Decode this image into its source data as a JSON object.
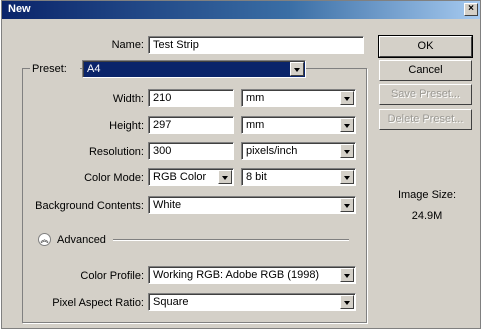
{
  "window": {
    "title": "New",
    "close": "×"
  },
  "labels": {
    "name": "Name:",
    "preset": "Preset:",
    "width": "Width:",
    "height": "Height:",
    "resolution": "Resolution:",
    "color_mode": "Color Mode:",
    "background_contents": "Background Contents:",
    "advanced": "Advanced",
    "color_profile": "Color Profile:",
    "pixel_aspect_ratio": "Pixel Aspect Ratio:"
  },
  "values": {
    "name": "Test Strip",
    "preset": "A4",
    "width": "210",
    "width_unit": "mm",
    "height": "297",
    "height_unit": "mm",
    "resolution": "300",
    "resolution_unit": "pixels/inch",
    "color_mode": "RGB Color",
    "bit_depth": "8 bit",
    "background_contents": "White",
    "color_profile": "Working RGB:  Adobe RGB (1998)",
    "pixel_aspect_ratio": "Square"
  },
  "buttons": {
    "ok": "OK",
    "cancel": "Cancel",
    "save_preset": "Save Preset...",
    "delete_preset": "Delete Preset..."
  },
  "image_size": {
    "label": "Image Size:",
    "value": "24.9M"
  },
  "icons": {
    "advanced_toggle": "double-chevron-up-icon",
    "dropdown": "triangle-down-icon"
  }
}
